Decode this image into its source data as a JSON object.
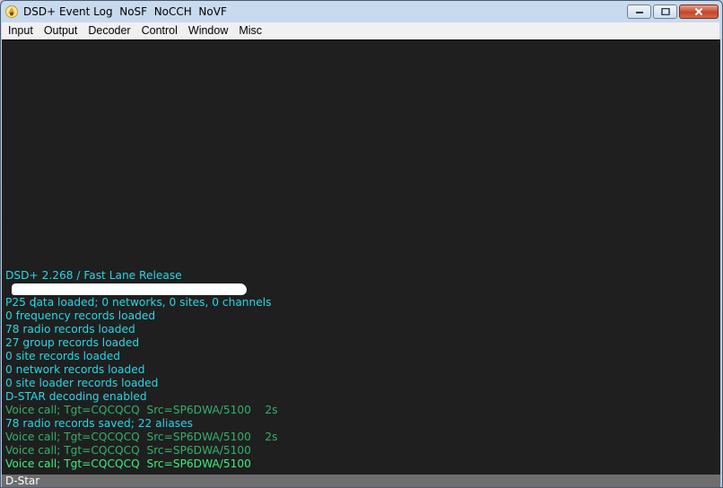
{
  "window": {
    "title": "DSD+ Event Log  NoSF  NoCCH  NoVF"
  },
  "menu": [
    {
      "label": "Input"
    },
    {
      "label": "Output"
    },
    {
      "label": "Decoder"
    },
    {
      "label": "Control"
    },
    {
      "label": "Window"
    },
    {
      "label": "Misc"
    }
  ],
  "log": {
    "lines": [
      {
        "text": "DSD+ 2.268 / Fast Lane Release",
        "color": "#28d7e6"
      },
      {
        "text": "[",
        "color": "#28d7e6",
        "redacted": true
      },
      {
        "text": "P25 data loaded; 0 networks, 0 sites, 0 channels",
        "color": "#28d7e6"
      },
      {
        "text": "0 frequency records loaded",
        "color": "#28d7e6"
      },
      {
        "text": "78 radio records loaded",
        "color": "#28d7e6"
      },
      {
        "text": "27 group records loaded",
        "color": "#28d7e6"
      },
      {
        "text": "0 site records loaded",
        "color": "#28d7e6"
      },
      {
        "text": "0 network records loaded",
        "color": "#28d7e6"
      },
      {
        "text": "0 site loader records loaded",
        "color": "#28d7e6"
      },
      {
        "text": "D-STAR decoding enabled",
        "color": "#28d7e6"
      },
      {
        "text": "Voice call; Tgt=CQCQCQ  Src=SP6DWA/5100    2s",
        "color": "#34b06a"
      },
      {
        "text": "78 radio records saved; 22 aliases",
        "color": "#28d7e6"
      },
      {
        "text": "Voice call; Tgt=CQCQCQ  Src=SP6DWA/5100    2s",
        "color": "#34b06a"
      },
      {
        "text": "Voice call; Tgt=CQCQCQ  Src=SP6DWA/5100",
        "color": "#34b06a"
      },
      {
        "text": "Voice call; Tgt=CQCQCQ  Src=SP6DWA/5100",
        "color": "#3df07a"
      }
    ]
  },
  "status": {
    "mode": "D-Star"
  }
}
